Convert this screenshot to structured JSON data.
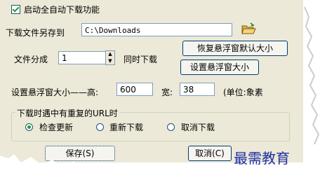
{
  "auto_download": {
    "label": "启动全自动下载功能",
    "checked": true
  },
  "save_path": {
    "label": "下载文件另存到",
    "value": "C:\\Downloads"
  },
  "split": {
    "label": "文件分成",
    "value": "1",
    "suffix": "同时下载"
  },
  "buttons": {
    "restore_default": "恢复悬浮窗默认大小",
    "set_size": "设置悬浮窗大小",
    "save": "保存(S)",
    "cancel": "取消(C)"
  },
  "float_size": {
    "label": "设置悬浮窗大小——高:",
    "height": "600",
    "width_label": "宽:",
    "width": "38",
    "unit_label": "(单位:象素"
  },
  "duplicate_url": {
    "legend": "下载时遇中有重复的URL时",
    "options": [
      {
        "label": "检查更新",
        "selected": true
      },
      {
        "label": "重新下载",
        "selected": false
      },
      {
        "label": "取消下载",
        "selected": false
      }
    ]
  },
  "watermark": "最需教育",
  "colors": {
    "panel": "#ece9d8",
    "accent": "#21a121",
    "watermark": "#1e2fa6"
  }
}
